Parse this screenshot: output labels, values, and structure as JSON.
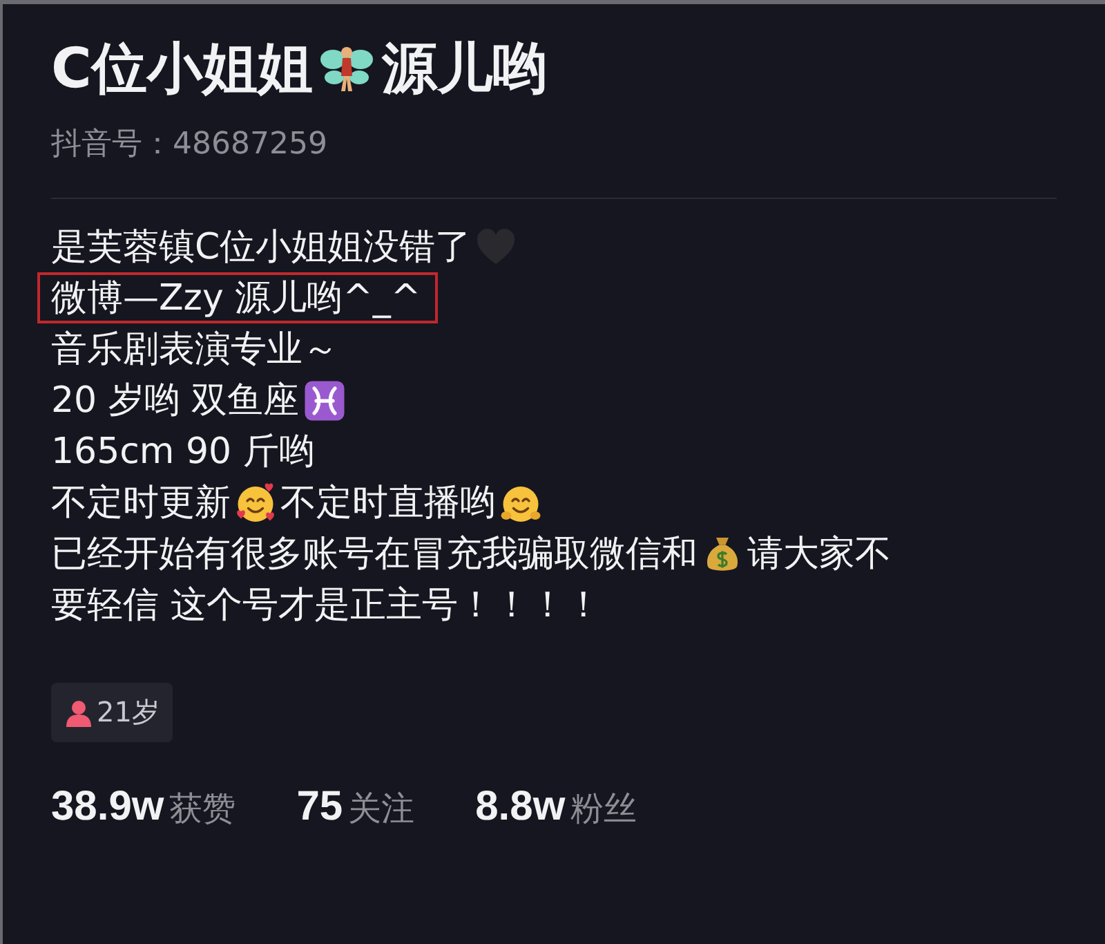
{
  "profile": {
    "name_segments": [
      {
        "kind": "text",
        "text": "C位小姐姐"
      },
      {
        "kind": "fairy"
      },
      {
        "kind": "text",
        "text": "源儿哟"
      }
    ],
    "id_label": "抖音号：48687259"
  },
  "bio": [
    {
      "highlighted": false,
      "segments": [
        {
          "kind": "text",
          "text": "是芙蓉镇C位小姐姐没错了"
        },
        {
          "kind": "heart"
        }
      ]
    },
    {
      "highlighted": true,
      "segments": [
        {
          "kind": "text",
          "text": "微博—Zzy 源儿哟^_^"
        }
      ]
    },
    {
      "highlighted": false,
      "segments": [
        {
          "kind": "text",
          "text": "音乐剧表演专业～"
        }
      ]
    },
    {
      "highlighted": false,
      "segments": [
        {
          "kind": "text",
          "text": "20 岁哟 双鱼座"
        },
        {
          "kind": "pisces"
        }
      ]
    },
    {
      "highlighted": false,
      "segments": [
        {
          "kind": "text",
          "text": "165cm 90 斤哟"
        }
      ]
    },
    {
      "highlighted": false,
      "segments": [
        {
          "kind": "text",
          "text": "不定时更新"
        },
        {
          "kind": "love"
        },
        {
          "kind": "text",
          "text": "不定时直播哟"
        },
        {
          "kind": "hug"
        }
      ]
    },
    {
      "highlighted": false,
      "segments": [
        {
          "kind": "text",
          "text": "已经开始有很多账号在冒充我骗取微信和"
        },
        {
          "kind": "money"
        },
        {
          "kind": "text",
          "text": "请大家不"
        }
      ]
    },
    {
      "highlighted": false,
      "segments": [
        {
          "kind": "text",
          "text": "要轻信 这个号才是正主号！！！！"
        }
      ]
    }
  ],
  "tags": [
    {
      "text": "21岁"
    }
  ],
  "stats": [
    {
      "count": "38.9w",
      "word_after": "获赞"
    },
    {
      "count": "75",
      "word_after": "关注"
    },
    {
      "count": "8.8w",
      "word_after": "粉丝"
    }
  ]
}
